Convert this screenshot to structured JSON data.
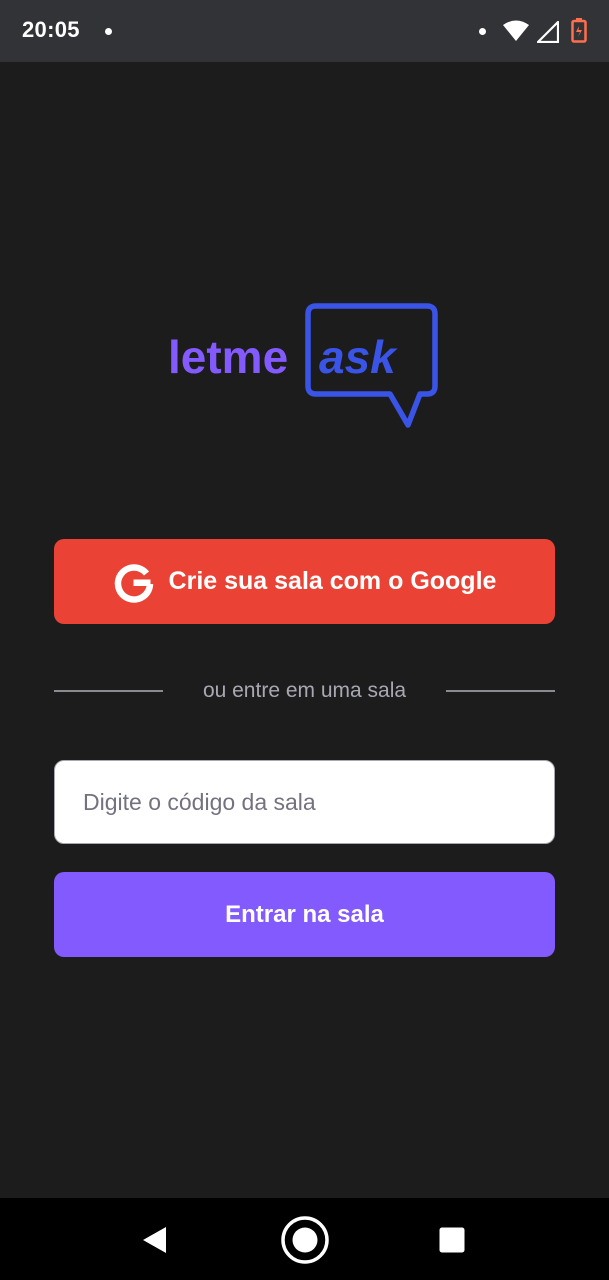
{
  "status_bar": {
    "time": "20:05",
    "icons": [
      "notification-dot-icon",
      "wifi-icon",
      "cell-signal-icon",
      "battery-icon"
    ]
  },
  "logo": {
    "text_primary": "letme",
    "text_accent": "ask",
    "colors": {
      "primary": "#835afd",
      "accent": "#3a54e8"
    }
  },
  "google_button": {
    "label": "Crie sua sala com o Google",
    "icon": "google-icon",
    "color": "#ea4335"
  },
  "separator": {
    "text": "ou entre em uma sala"
  },
  "room_form": {
    "code_placeholder": "Digite o código da sala",
    "code_value": "",
    "submit_label": "Entrar na sala",
    "submit_color": "#835afd"
  },
  "nav_bar": {
    "buttons": [
      "back-icon",
      "home-icon",
      "recents-icon"
    ]
  }
}
